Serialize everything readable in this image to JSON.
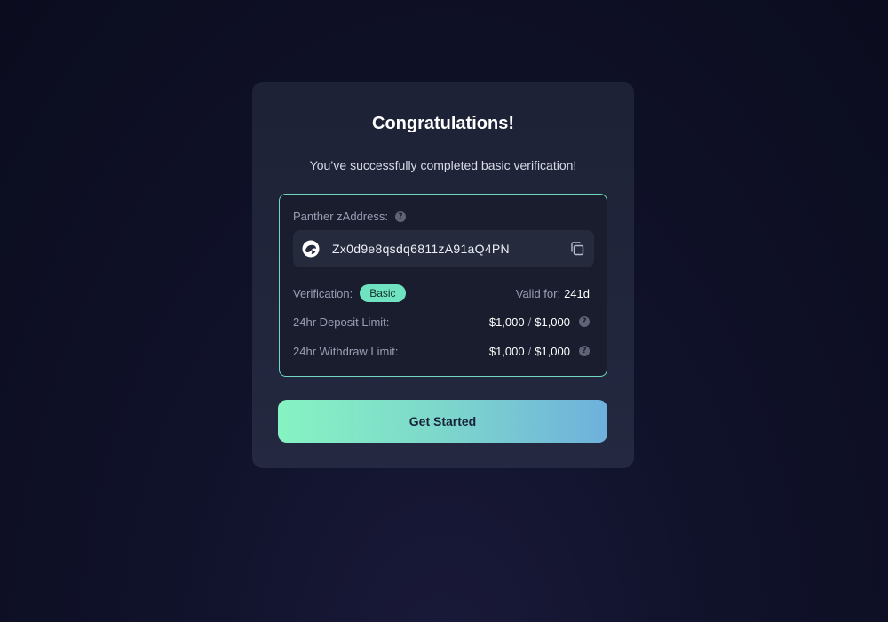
{
  "dialog": {
    "title": "Congratulations!",
    "subtitle": "You’ve successfully completed basic verification!"
  },
  "address": {
    "label": "Panther zAddress:",
    "value": "Zx0d9e8qsdq6811zA91aQ4PN",
    "logo_icon": "panther-logo-icon",
    "copy_icon": "copy-icon"
  },
  "verification": {
    "label": "Verification:",
    "level": "Basic",
    "valid_label": "Valid for:",
    "valid_value": "241d"
  },
  "deposit": {
    "label": "24hr Deposit Limit:",
    "used": "$1,000",
    "separator": "/",
    "total": "$1,000"
  },
  "withdraw": {
    "label": "24hr Withdraw Limit:",
    "used": "$1,000",
    "separator": "/",
    "total": "$1,000"
  },
  "help_glyph": "?",
  "cta": {
    "label": "Get Started"
  },
  "colors": {
    "accent": "#6fe3c0",
    "background": "#0e1024",
    "card": "#1e2236"
  }
}
